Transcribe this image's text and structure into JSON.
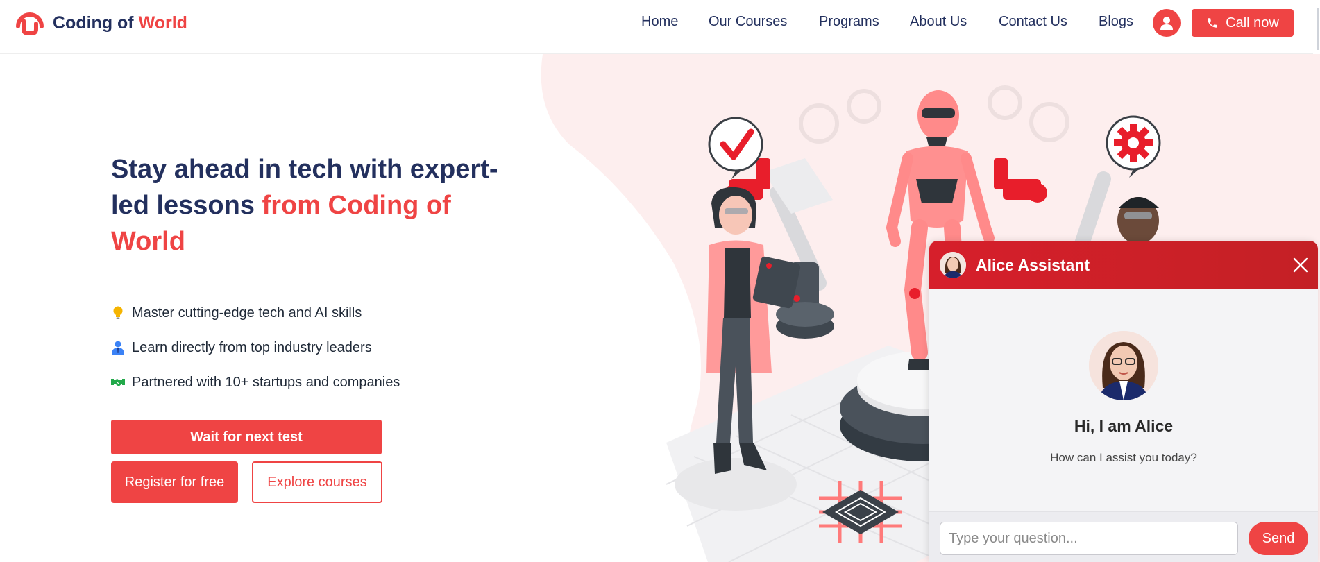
{
  "brand": {
    "name_part1": "Coding of",
    "name_part2": "World",
    "accent_color": "#ef4444",
    "text_color": "#23305e"
  },
  "nav": {
    "items": [
      {
        "label": "Home"
      },
      {
        "label": "Our Courses"
      },
      {
        "label": "Programs"
      },
      {
        "label": "About Us"
      },
      {
        "label": "Contact Us"
      },
      {
        "label": "Blogs"
      }
    ],
    "user_icon": "user-icon",
    "call_label": "Call now",
    "call_icon": "phone-icon"
  },
  "hero": {
    "title_main": "Stay ahead in tech with expert-led lessons",
    "title_accent": "from Coding of World",
    "features": [
      {
        "icon": "lightbulb-icon",
        "text": "Master cutting-edge tech and AI skills"
      },
      {
        "icon": "person-icon",
        "text": "Learn directly from top industry leaders"
      },
      {
        "icon": "handshake-icon",
        "text": "Partnered with 10+ startups and companies"
      }
    ],
    "wait_button": "Wait for next test",
    "register_button": "Register for free",
    "explore_button": "Explore courses"
  },
  "chat": {
    "assistant_name": "Alice Assistant",
    "greeting": "Hi, I am Alice",
    "prompt": "How can I assist you today?",
    "input_placeholder": "Type your question...",
    "send_label": "Send",
    "header_color": "#d61f2b"
  }
}
